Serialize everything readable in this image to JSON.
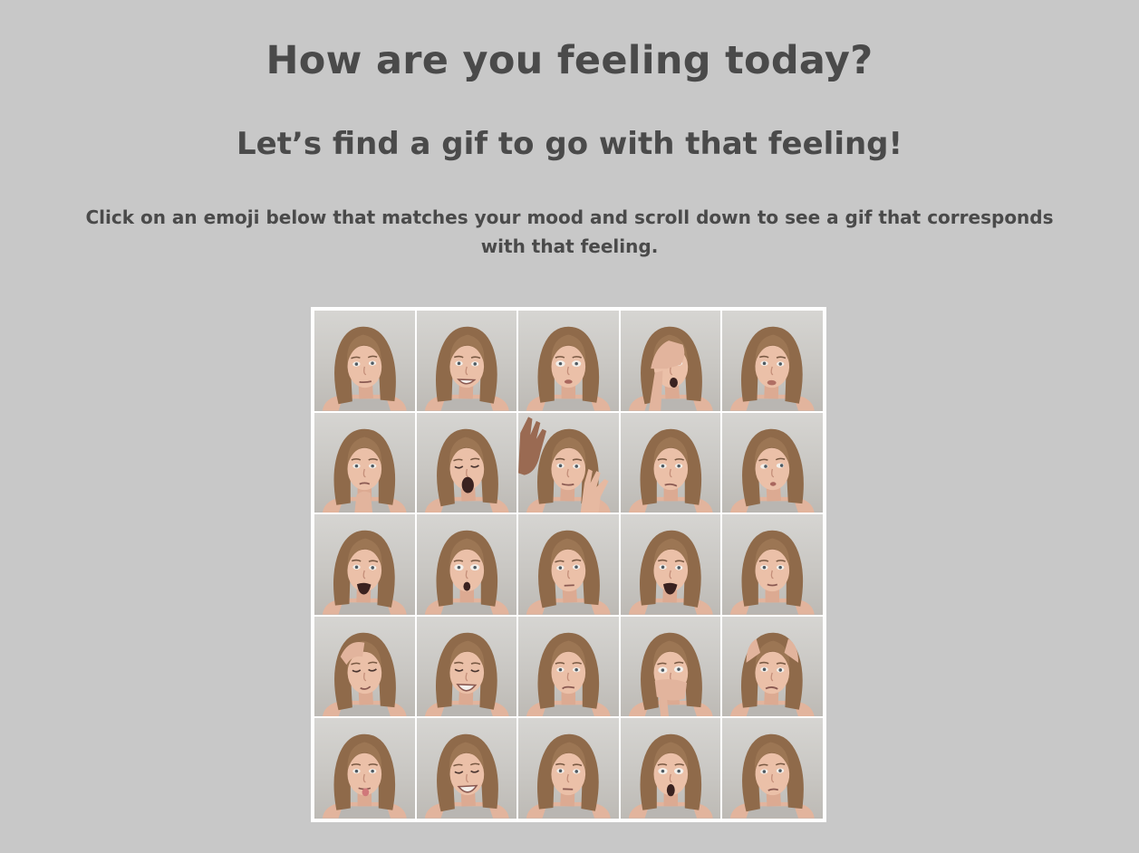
{
  "header": {
    "title": "How are you feeling today?",
    "subtitle": "Let’s find a gif to go with that feeling!",
    "instructions": "Click on an emoji below that matches your mood and scroll down to see a gif that corresponds with that feeling."
  },
  "colors": {
    "background": "#c8c8c8",
    "text": "#4a4a4a",
    "grid_border": "#ffffff"
  },
  "mood_grid": {
    "rows": 5,
    "columns": 5,
    "tiles": [
      {
        "expression": "neutral"
      },
      {
        "expression": "smile"
      },
      {
        "expression": "puffed"
      },
      {
        "expression": "facepalm"
      },
      {
        "expression": "pout"
      },
      {
        "expression": "thinking"
      },
      {
        "expression": "scream"
      },
      {
        "expression": "hands-up"
      },
      {
        "expression": "skeptical"
      },
      {
        "expression": "side-glance"
      },
      {
        "expression": "angry-shout"
      },
      {
        "expression": "shocked"
      },
      {
        "expression": "suspicious"
      },
      {
        "expression": "angry-shout"
      },
      {
        "expression": "calm"
      },
      {
        "expression": "headache"
      },
      {
        "expression": "laughing"
      },
      {
        "expression": "doubtful"
      },
      {
        "expression": "hand-over-mouth"
      },
      {
        "expression": "stressed"
      },
      {
        "expression": "tongue-out"
      },
      {
        "expression": "laughing"
      },
      {
        "expression": "unimpressed"
      },
      {
        "expression": "surprised"
      },
      {
        "expression": "annoyed"
      }
    ]
  }
}
